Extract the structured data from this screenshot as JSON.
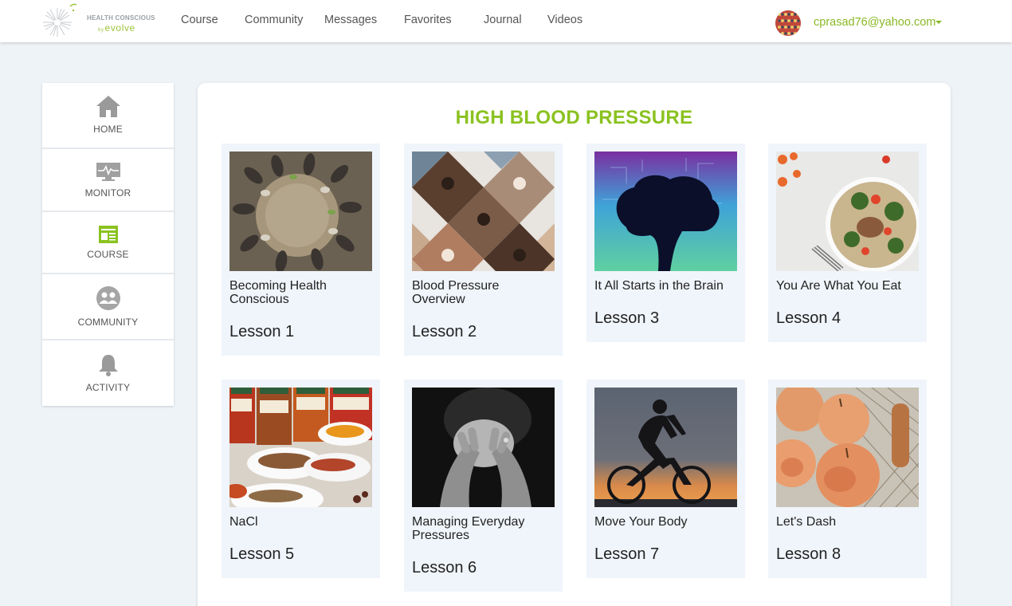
{
  "header": {
    "logo": {
      "brand": "HEALTH CONSCIOUS",
      "by": "by",
      "sub": "evolve"
    },
    "nav": [
      {
        "label": "Course"
      },
      {
        "label": "Community"
      },
      {
        "label": "Messages"
      },
      {
        "label": "Favorites"
      },
      {
        "label": "Journal"
      },
      {
        "label": "Videos"
      }
    ],
    "user_email": "cprasad76@yahoo.com",
    "accent_color": "#8ab825"
  },
  "sidebar": {
    "items": [
      {
        "label": "HOME",
        "icon": "home-icon"
      },
      {
        "label": "MONITOR",
        "icon": "monitor-icon"
      },
      {
        "label": "COURSE",
        "icon": "course-icon",
        "active": true
      },
      {
        "label": "COMMUNITY",
        "icon": "community-icon"
      },
      {
        "label": "ACTIVITY",
        "icon": "bell-icon"
      }
    ]
  },
  "main": {
    "title": "HIGH BLOOD PRESSURE",
    "title_color": "#8bc220",
    "lessons": [
      {
        "title": "Becoming Health Conscious",
        "lesson": "Lesson 1",
        "image": "feet-circle-photo"
      },
      {
        "title": "Blood Pressure Overview",
        "lesson": "Lesson 2",
        "image": "faces-collage-photo"
      },
      {
        "title": "It All Starts in the Brain",
        "lesson": "Lesson 3",
        "image": "brain-circuit-photo"
      },
      {
        "title": "You Are What You Eat",
        "lesson": "Lesson 4",
        "image": "food-bowl-photo"
      },
      {
        "title": "NaCl",
        "lesson": "Lesson 5",
        "image": "spices-photo"
      },
      {
        "title": "Managing Everyday Pressures",
        "lesson": "Lesson 6",
        "image": "stressed-person-photo"
      },
      {
        "title": "Move Your Body",
        "lesson": "Lesson 7",
        "image": "cyclist-photo"
      },
      {
        "title": "Let's Dash",
        "lesson": "Lesson 8",
        "image": "apples-photo"
      }
    ]
  }
}
